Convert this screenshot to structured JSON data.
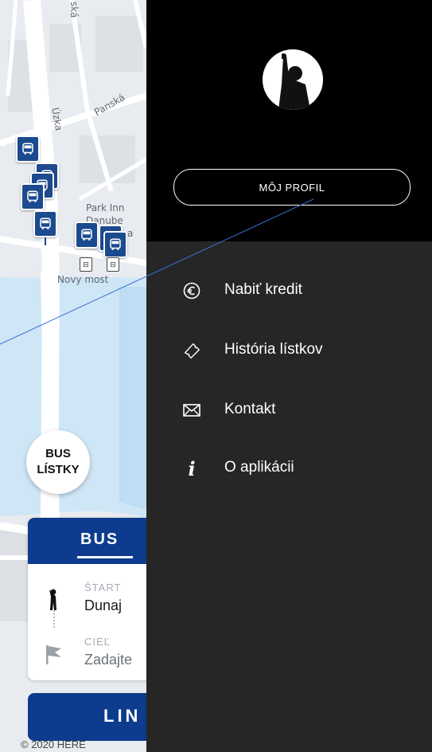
{
  "map": {
    "street_labels": [
      "ská",
      "Úzka",
      "Panská",
      "Park Inn",
      "Danube",
      "a",
      "Novy most"
    ],
    "stop_glyph": "⊟",
    "copyright": "© 2020 HERE"
  },
  "bus_tickets_button": {
    "line1": "BUS",
    "line2": "LÍSTKY"
  },
  "trip_card": {
    "tab_label": "BUS",
    "start": {
      "label": "ŠTART",
      "value": "Dunaj"
    },
    "destination": {
      "label": "CIEĽ",
      "placeholder": "Zadajte"
    }
  },
  "lines_button": {
    "label": "LIN"
  },
  "drawer": {
    "profile_button": "MÔJ PROFIL",
    "menu": [
      {
        "icon": "euro-icon",
        "label": "Nabiť kredit"
      },
      {
        "icon": "ticket-icon",
        "label": "História lístkov"
      },
      {
        "icon": "envelope-icon",
        "label": "Kontakt"
      },
      {
        "icon": "info-icon",
        "glyph": "i",
        "label": "O aplikácii"
      }
    ]
  },
  "colors": {
    "brand_blue": "#0d3b8e",
    "marker_blue": "#1c4a8e",
    "drawer_bg": "#262626",
    "drawer_header": "#000000",
    "river": "#cfe6f7"
  }
}
